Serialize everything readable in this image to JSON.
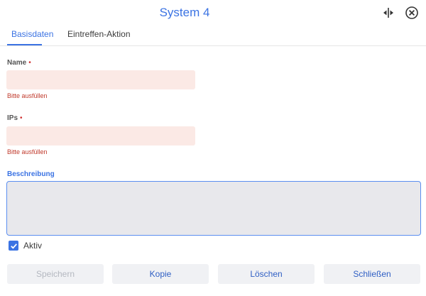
{
  "dialog": {
    "title": "System 4"
  },
  "icons": {
    "split": "split-view-icon",
    "close": "close-circle-icon"
  },
  "tabs": [
    {
      "label": "Basisdaten",
      "active": true
    },
    {
      "label": "Eintreffen-Aktion",
      "active": false
    }
  ],
  "fields": {
    "name": {
      "label": "Name",
      "required_mark": "•",
      "value": "",
      "error": "Bitte ausfüllen"
    },
    "ips": {
      "label": "IPs",
      "required_mark": "•",
      "value": "",
      "error": "Bitte ausfüllen"
    },
    "description": {
      "label": "Beschreibung",
      "value": ""
    }
  },
  "active_checkbox": {
    "label": "Aktiv",
    "checked": true
  },
  "buttons": {
    "save": "Speichern",
    "copy": "Kopie",
    "delete": "Löschen",
    "close": "Schließen"
  },
  "colors": {
    "accent": "#3b73e3",
    "error": "#c0392b",
    "invalid_field_bg": "#fbe9e5",
    "button_bg": "#f0f1f4"
  }
}
